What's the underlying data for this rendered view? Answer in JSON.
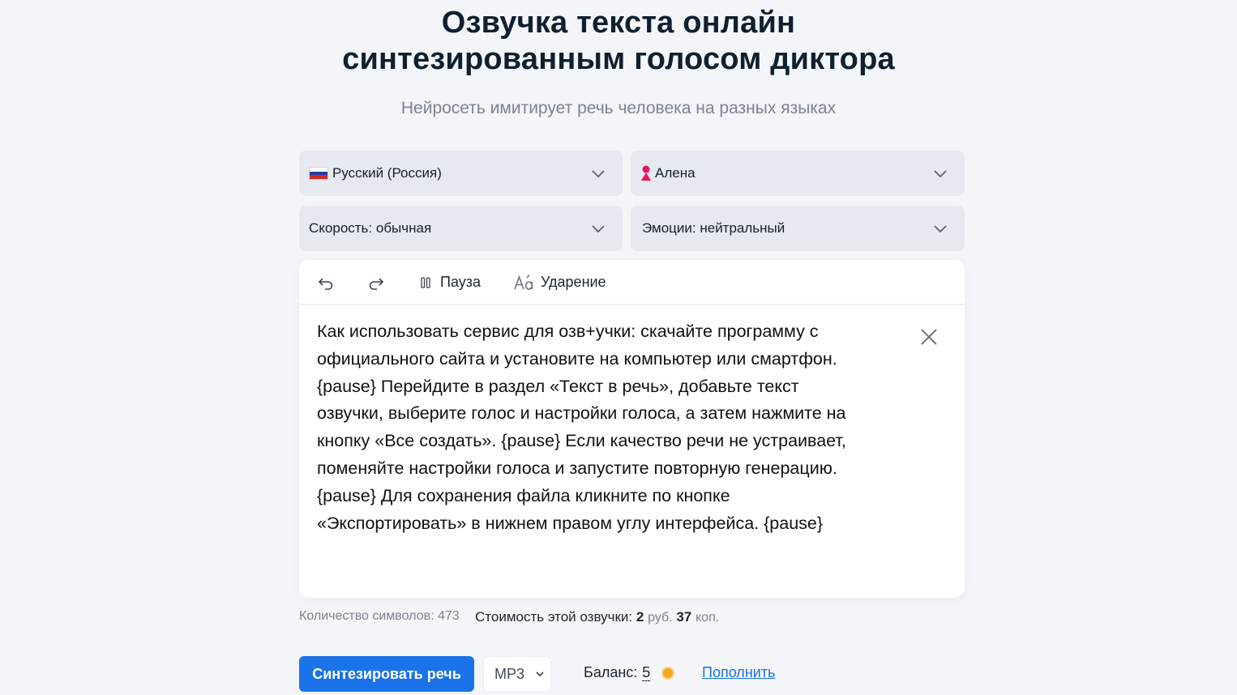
{
  "header": {
    "title_line1": "Озвучка текста онлайн",
    "title_line2": "синтезированным голосом диктора",
    "subtitle": "Нейросеть имитирует речь человека на разных языках"
  },
  "selectors": {
    "language": "Русский (Россия)",
    "voice": "Алена",
    "speed": "Скорость: обычная",
    "emotion": "Эмоции: нейтральный"
  },
  "toolbar": {
    "pause_label": "Пауза",
    "stress_label": "Ударение"
  },
  "editor": {
    "text": "Как использовать сервис для озв+учки: скачайте программу с\nофициального сайта и установите на компьютер или смартфон.\n{pause} Перейдите в раздел «Текст в речь», добавьте текст\nозвучки, выберите голос и настройки голоса, а затем нажмите на\nкнопку «Все создать».  {pause}  Если качество речи не устраивает,\nпоменяйте настройки голоса и запустите повторную генерацию.\n{pause}  Для сохранения файла кликните по кнопке\n«Экспортировать» в нижнем правом углу интерфейса. {pause}"
  },
  "stats": {
    "chars_label": "Количество символов:",
    "chars_value": "473",
    "cost_label": "Стоимость этой озвучки:",
    "cost_rub": "2",
    "rub_unit": "руб.",
    "cost_kop": "37",
    "kop_unit": "коп."
  },
  "actions": {
    "synthesize_label": "Синтезировать речь",
    "format_value": "MP3",
    "balance_label": "Баланс:",
    "balance_value": "5",
    "topup_label": "Пополнить"
  },
  "colors": {
    "accent": "#1a73e8",
    "background": "#f4f5f9",
    "select_bg": "#e7e9f0",
    "coin": "#f5a623",
    "voice_icon": "#e8145a"
  },
  "icons": [
    "chevron-down-icon",
    "flag-russia-icon",
    "female-voice-icon",
    "undo-icon",
    "redo-icon",
    "pause-icon",
    "stress-icon",
    "close-icon",
    "coin-icon"
  ]
}
